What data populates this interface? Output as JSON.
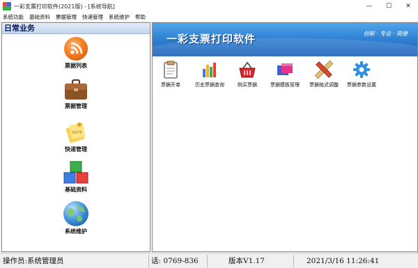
{
  "window": {
    "title": "一彩支票打印软件(2021版) - [系统导航]",
    "controls": {
      "minimize": "—",
      "maximize": "☐",
      "close": "✕"
    }
  },
  "menu": [
    "系统功能",
    "基础资料",
    "票据管理",
    "快递管理",
    "系统维护",
    "帮助"
  ],
  "sidebar": {
    "header": "日常业务",
    "items": [
      {
        "label": "票据列表",
        "icon": "rss-feed-icon"
      },
      {
        "label": "票据管理",
        "icon": "briefcase-icon"
      },
      {
        "label": "快递管理",
        "icon": "sticky-note-icon"
      },
      {
        "label": "基础资料",
        "icon": "blocks-icon"
      },
      {
        "label": "系统维护",
        "icon": "globe-icon"
      }
    ]
  },
  "banner": {
    "title": "一彩支票打印软件",
    "slogan": "创新 · 专业 · 简便"
  },
  "toolbar": [
    {
      "label": "票据开单",
      "icon": "clipboard-icon"
    },
    {
      "label": "历史票据查询",
      "icon": "bar-chart-icon"
    },
    {
      "label": "购买票据",
      "icon": "shopping-basket-icon"
    },
    {
      "label": "票据模板管理",
      "icon": "template-icon"
    },
    {
      "label": "票据格式调整",
      "icon": "ruler-pencil-icon"
    },
    {
      "label": "票据参数设置",
      "icon": "gear-icon"
    }
  ],
  "status": {
    "operator": "操作员:系统管理员",
    "phone": "话: 0769-836",
    "version": "版本V1.17",
    "datetime": "2021/3/16 11:26:41"
  }
}
